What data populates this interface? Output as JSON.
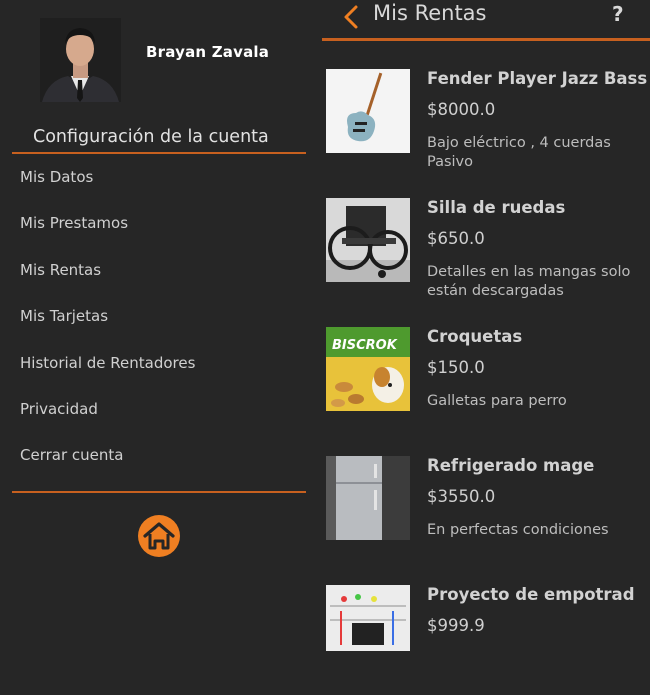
{
  "user": {
    "name": "Brayan Zavala"
  },
  "drawer": {
    "section_title": "Configuración de la cuenta",
    "menu": [
      "Mis Datos",
      "Mis Prestamos",
      "Mis Rentas",
      "Mis Tarjetas",
      "Historial de Rentadores",
      "Privacidad",
      "Cerrar cuenta"
    ],
    "home_icon": "home-icon"
  },
  "header": {
    "title": "Mis Rentas",
    "help": "?",
    "back_icon": "chevron-left-icon"
  },
  "rentals": [
    {
      "title": "Fender Player Jazz Bass",
      "price": "$8000.0",
      "description": "Bajo eléctrico , 4 cuerdas Pasivo",
      "thumb": "bass-guitar"
    },
    {
      "title": "Silla de ruedas",
      "price": "$650.0",
      "description": "Detalles en las mangas solo están descargadas",
      "thumb": "wheelchair"
    },
    {
      "title": "Croquetas",
      "price": "$150.0",
      "description": "Galletas para perro",
      "thumb": "dog-biscuits",
      "thumb_text": "BISCROK"
    },
    {
      "title": "Refrigerado mage",
      "price": "$3550.0",
      "description": "En perfectas condiciones",
      "thumb": "refrigerator"
    },
    {
      "title": "Proyecto de empotrad",
      "price": "$999.9",
      "description": "",
      "thumb": "breadboard"
    }
  ],
  "colors": {
    "background": "#262626",
    "accent": "#ef7f22",
    "divider": "#c7601f",
    "text": "#d0d0d0"
  }
}
